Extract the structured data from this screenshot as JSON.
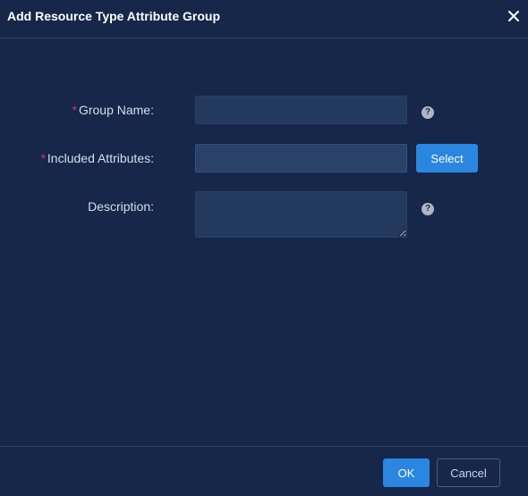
{
  "dialog": {
    "title": "Add Resource Type Attribute Group"
  },
  "form": {
    "group_name": {
      "label": "Group Name:",
      "required_mark": "*",
      "value": "",
      "placeholder": ""
    },
    "included_attributes": {
      "label": "Included Attributes:",
      "required_mark": "*",
      "value": "",
      "placeholder": "",
      "select_label": "Select"
    },
    "description": {
      "label": "Description:",
      "value": "",
      "placeholder": ""
    },
    "help_glyph": "?"
  },
  "footer": {
    "ok_label": "OK",
    "cancel_label": "Cancel"
  },
  "colors": {
    "background": "#16274a",
    "accent": "#2a86e0",
    "required": "#e0336b"
  }
}
